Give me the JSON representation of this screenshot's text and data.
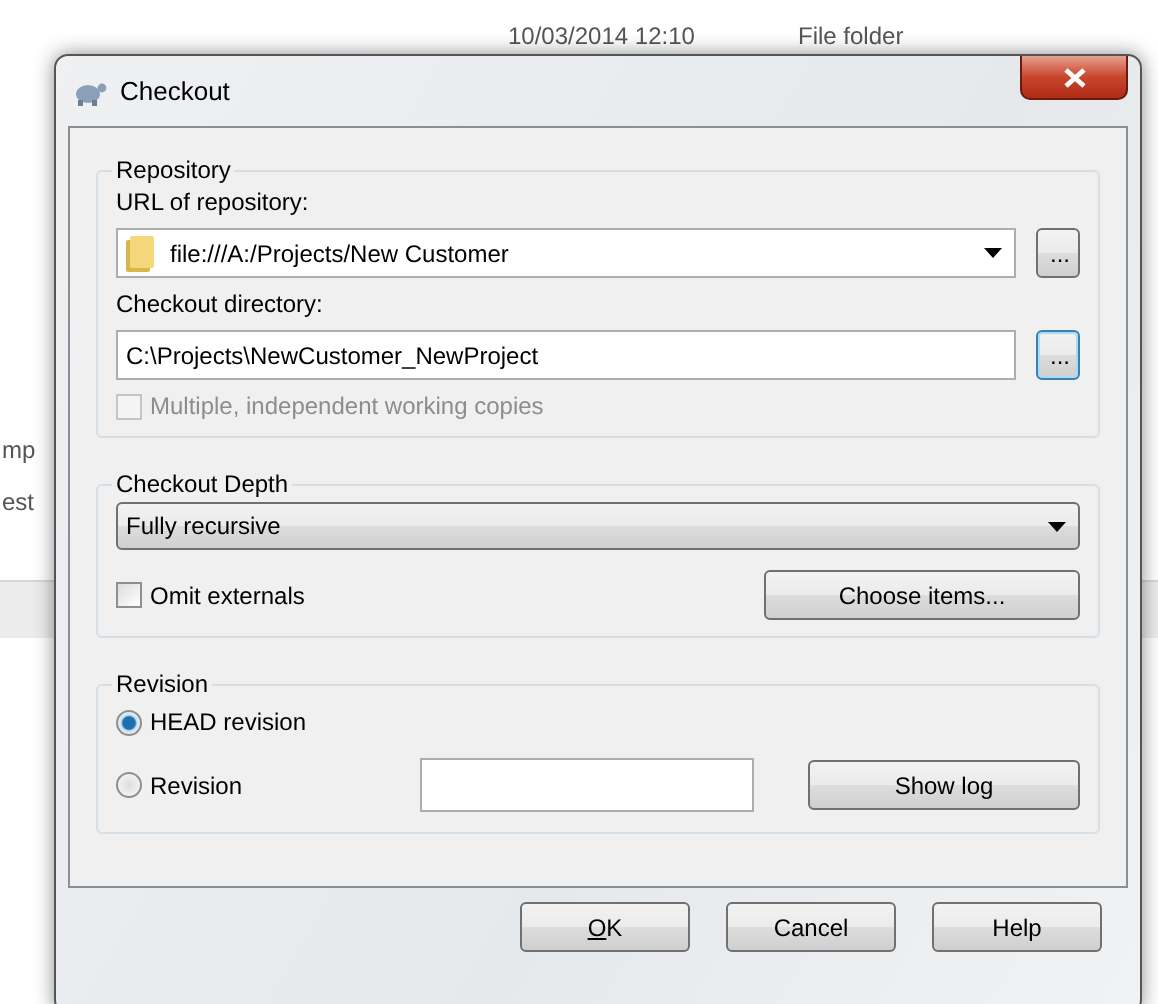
{
  "background": {
    "texts": [
      {
        "kind": "date",
        "text": "10/03/2014 12:10"
      },
      {
        "kind": "type",
        "text": "File folder"
      },
      {
        "kind": "left1",
        "text": "mp"
      },
      {
        "kind": "left2",
        "text": "est"
      }
    ]
  },
  "window": {
    "title": "Checkout"
  },
  "repository": {
    "legend": "Repository",
    "url_label": "URL of repository:",
    "url_value": "file:///A:/Projects/New Customer",
    "url_browse": {
      "label": "...",
      "focused": false
    },
    "directory_label": "Checkout directory:",
    "directory_value": "C:\\Projects\\NewCustomer_NewProject",
    "directory_browse": {
      "label": "...",
      "focused": true
    },
    "multiple_copies": {
      "label": "Multiple, independent working copies",
      "checked": false,
      "disabled": true
    }
  },
  "depth": {
    "legend": "Checkout Depth",
    "value": "Fully recursive",
    "omit_externals": {
      "label": "Omit externals",
      "checked": false,
      "disabled": false
    },
    "choose_items": "Choose items..."
  },
  "revision": {
    "legend": "Revision",
    "options": [
      {
        "label": "HEAD revision",
        "selected": true
      },
      {
        "label": "Revision",
        "selected": false
      }
    ],
    "show_log": "Show log"
  },
  "buttons": [
    {
      "label": "OK",
      "mnemonic": true
    },
    {
      "label": "Cancel",
      "mnemonic": false
    },
    {
      "label": "Help",
      "mnemonic": false
    }
  ]
}
